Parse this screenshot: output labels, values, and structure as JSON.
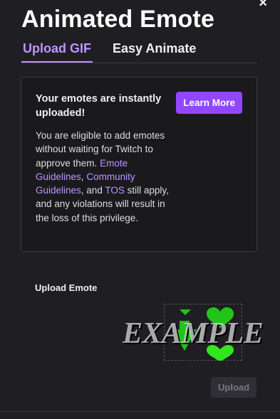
{
  "dialog": {
    "title": "Animated Emote",
    "close_icon": "close-icon",
    "close_glyph": "×"
  },
  "tabs": [
    {
      "label": "Upload GIF",
      "active": true
    },
    {
      "label": "Easy Animate",
      "active": false
    }
  ],
  "info": {
    "heading": "Your emotes are instantly uploaded!",
    "learn_more_label": "Learn More",
    "body_intro": "You are eligible to add emotes without waiting for Twitch to approve them.",
    "link_emote_guidelines": "Emote Guidelines",
    "sep_comma": ",",
    "link_community_guidelines": "Community Guidelines",
    "and_text": ", and",
    "link_tos": "TOS",
    "body_outro": "still apply, and any violations will result in the loss of this privilege."
  },
  "upload": {
    "label": "Upload Emote",
    "watermark": "EXAMPLE",
    "button_label": "Upload",
    "button_enabled": false
  },
  "colors": {
    "accent": "#9147ff",
    "link": "#bf94ff",
    "background": "#1f1f23",
    "preview_green": "#22c41a"
  }
}
